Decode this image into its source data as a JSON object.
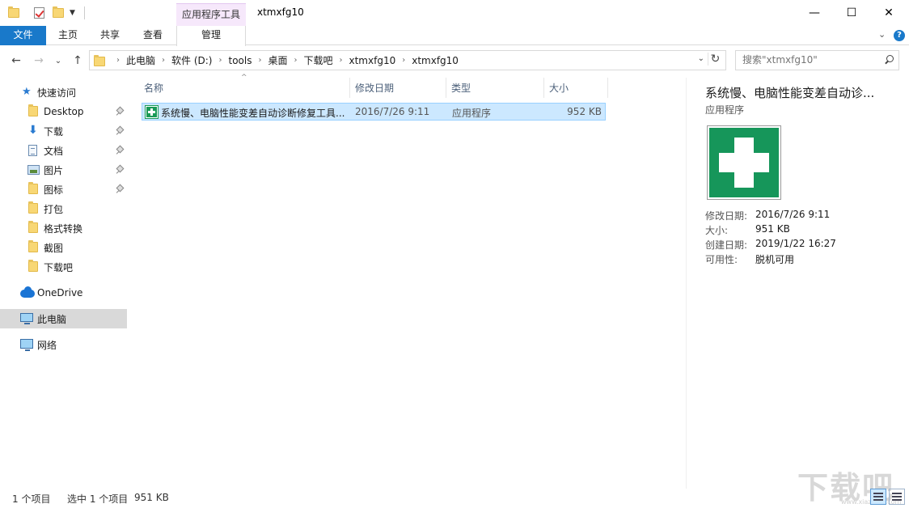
{
  "titlebar": {
    "contextual_tab_title": "应用程序工具",
    "window_title": "xtmxfg10",
    "minimize": "—",
    "maximize": "☐",
    "close": "✕"
  },
  "ribbon": {
    "tabs": [
      {
        "label": "文件"
      },
      {
        "label": "主页"
      },
      {
        "label": "共享"
      },
      {
        "label": "查看"
      },
      {
        "label": "管理"
      }
    ],
    "collapse_glyph": "⌄",
    "help_glyph": "?"
  },
  "nav": {
    "back": "←",
    "forward": "→",
    "recent": "⌄",
    "up": "↑"
  },
  "address": {
    "crumbs": [
      "此电脑",
      "软件 (D:)",
      "tools",
      "桌面",
      "下载吧",
      "xtmxfg10",
      "xtmxfg10"
    ],
    "separator": "›",
    "dropdown": "⌄",
    "refresh": "↻"
  },
  "search": {
    "placeholder": "搜索\"xtmxfg10\""
  },
  "sidebar": {
    "quick_access": "快速访问",
    "items": [
      {
        "label": "Desktop"
      },
      {
        "label": "下载"
      },
      {
        "label": "文档"
      },
      {
        "label": "图片"
      },
      {
        "label": "图标"
      },
      {
        "label": "打包"
      },
      {
        "label": "格式转换"
      },
      {
        "label": "截图"
      },
      {
        "label": "下载吧"
      }
    ],
    "onedrive": "OneDrive",
    "this_pc": "此电脑",
    "network": "网络"
  },
  "columns": {
    "name": "名称",
    "date": "修改日期",
    "type": "类型",
    "size": "大小",
    "sort_glyph": "^"
  },
  "files": [
    {
      "name": "系统慢、电脑性能变差自动诊断修复工具...",
      "date": "2016/7/26 9:11",
      "type": "应用程序",
      "size": "952 KB"
    }
  ],
  "details": {
    "title": "系统慢、电脑性能变差自动诊...",
    "type": "应用程序",
    "props": [
      {
        "key": "修改日期:",
        "value": "2016/7/26 9:11"
      },
      {
        "key": "大小:",
        "value": "951 KB"
      },
      {
        "key": "创建日期:",
        "value": "2019/1/22 16:27"
      },
      {
        "key": "可用性:",
        "value": "脱机可用"
      }
    ]
  },
  "status": {
    "count": "1 个项目",
    "selected": "选中 1 个项目",
    "size": "951 KB"
  },
  "watermark": {
    "text": "下载吧",
    "sub": "www.xiazaiba.com"
  },
  "colors": {
    "accent": "#1979ca",
    "selection": "#cce8ff",
    "app_icon_green": "#16965a"
  }
}
